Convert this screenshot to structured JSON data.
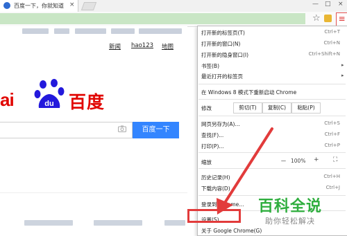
{
  "browser": {
    "tab_title": "百度一下，你就知道",
    "tab_close": "×",
    "window_controls": [
      "—",
      "□",
      "×"
    ],
    "star_icon": "☆",
    "menu_icon": "≡"
  },
  "page": {
    "nav": [
      "新闻",
      "hao123",
      "地图"
    ],
    "logo_left": "ai",
    "logo_badge": "du",
    "logo_cn": "百度",
    "search_button": "百度一下"
  },
  "menu": {
    "items": [
      {
        "label": "打开新的标签页(T)",
        "shortcut": "Ctrl+T"
      },
      {
        "label": "打开新的窗口(N)",
        "shortcut": "Ctrl+N"
      },
      {
        "label": "打开新的隐身窗口(I)",
        "shortcut": "Ctrl+Shift+N"
      },
      {
        "label": "书签(B)",
        "shortcut": ""
      },
      {
        "label": "最近打开的标签页",
        "shortcut": ""
      },
      {
        "label": "在 Windows 8 模式下重新启动 Chrome",
        "shortcut": ""
      },
      {
        "label": "修改",
        "shortcut": ""
      },
      {
        "label": "网页另存为(A)...",
        "shortcut": "Ctrl+S"
      },
      {
        "label": "查找(F)...",
        "shortcut": "Ctrl+F"
      },
      {
        "label": "打印(P)...",
        "shortcut": "Ctrl+P"
      },
      {
        "label": "缩放",
        "shortcut": ""
      },
      {
        "label": "历史记录(H)",
        "shortcut": "Ctrl+H"
      },
      {
        "label": "下载内容(D)",
        "shortcut": "Ctrl+J"
      },
      {
        "label": "登录到 Chrome...",
        "shortcut": ""
      },
      {
        "label": "设置(S)",
        "shortcut": ""
      },
      {
        "label": "关于 Google Chrome(G)",
        "shortcut": ""
      }
    ],
    "edit_buttons": [
      "剪切(T)",
      "复制(C)",
      "粘贴(P)"
    ],
    "zoom": {
      "minus": "－",
      "value": "100%",
      "plus": "+",
      "fullscreen": "⛶"
    },
    "submenu_arrow": "▸"
  },
  "watermark": {
    "main": "百科全说",
    "sub": "助你轻松解决"
  }
}
